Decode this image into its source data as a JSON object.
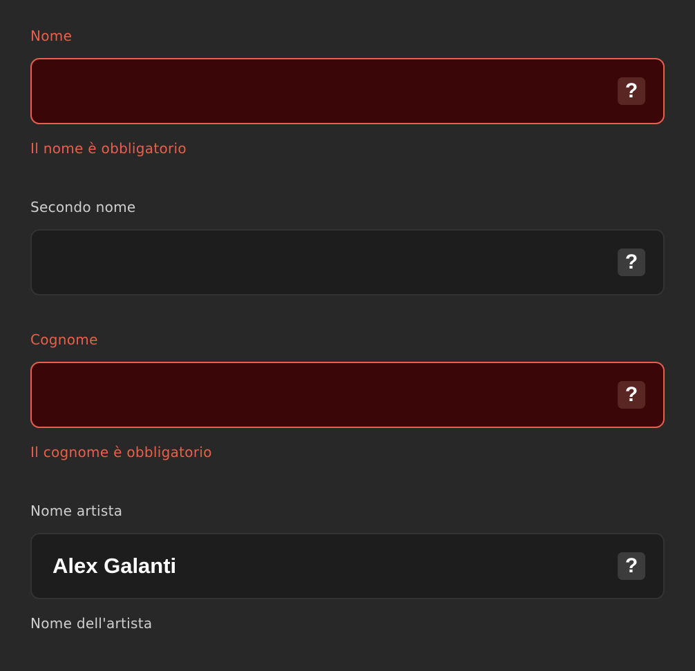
{
  "fields": [
    {
      "label": "Nome",
      "value": "",
      "help_icon": "?",
      "state": "error",
      "message": "Il nome è obbligatorio"
    },
    {
      "label": "Secondo nome",
      "value": "",
      "help_icon": "?",
      "state": "normal",
      "message": ""
    },
    {
      "label": "Cognome",
      "value": "",
      "help_icon": "?",
      "state": "error",
      "message": "Il cognome è obbligatorio"
    },
    {
      "label": "Nome artista",
      "value": "Alex Galanti",
      "help_icon": "?",
      "state": "normal",
      "message": "Nome dell'artista"
    }
  ],
  "colors": {
    "background": "#282828",
    "error": "#e8604c",
    "error_fill": "#3b0607",
    "input_fill": "#1d1d1d",
    "label": "#cfcfcf"
  },
  "icons": {
    "help": "question-mark-icon"
  }
}
